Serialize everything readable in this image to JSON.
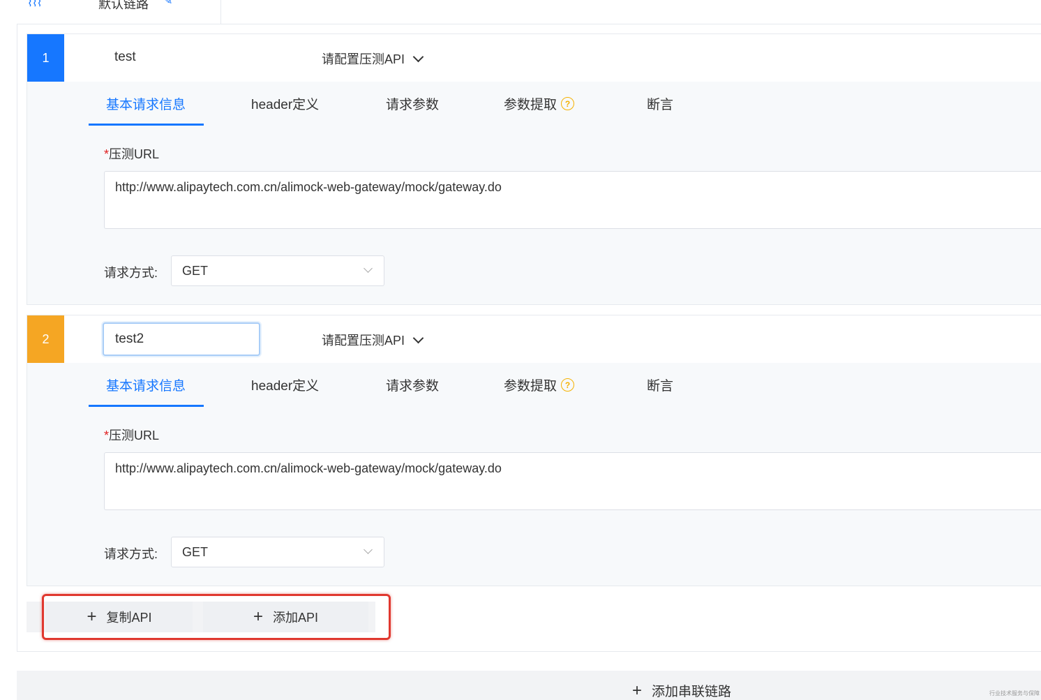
{
  "chain": {
    "name": "默认链路",
    "icon": "chain-icon",
    "edit_icon": "edit-icon"
  },
  "apis": [
    {
      "index": "1",
      "badge_color": "#1677ff",
      "name": "test",
      "editing": false,
      "select_label": "请配置压测API",
      "tabs": [
        "基本请求信息",
        "header定义",
        "请求参数",
        "参数提取",
        "断言"
      ],
      "active_tab": "基本请求信息",
      "url_label_required": "*",
      "url_label": "压测URL",
      "url": "http://www.alipaytech.com.cn/alimock-web-gateway/mock/gateway.do",
      "method_label": "请求方式:",
      "method": "GET"
    },
    {
      "index": "2",
      "badge_color": "#f5a623",
      "name": "test2",
      "editing": true,
      "select_label": "请配置压测API",
      "tabs": [
        "基本请求信息",
        "header定义",
        "请求参数",
        "参数提取",
        "断言"
      ],
      "active_tab": "基本请求信息",
      "url_label_required": "*",
      "url_label": "压测URL",
      "url": "http://www.alipaytech.com.cn/alimock-web-gateway/mock/gateway.do",
      "method_label": "请求方式:",
      "method": "GET"
    }
  ],
  "actions": {
    "copy_api": "复制API",
    "add_api": "添加API",
    "plus": "+"
  },
  "add_chain": {
    "label": "添加串联链路",
    "plus": "+"
  },
  "watermark": "行业技术服务与保障",
  "colors": {
    "accent": "#1677ff",
    "warning": "#f5b100",
    "highlight": "#e0382f"
  }
}
